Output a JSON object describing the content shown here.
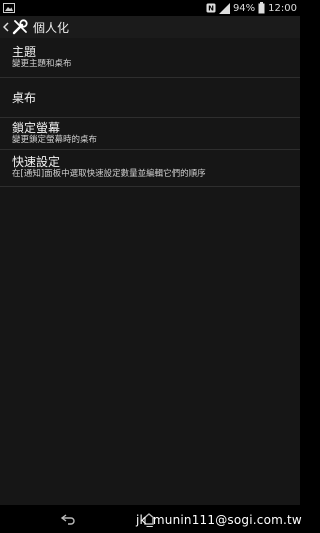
{
  "status_bar": {
    "battery": "94%",
    "time": "12:00",
    "icons": [
      "image-icon",
      "nfc-icon",
      "signal-icon",
      "battery-icon"
    ]
  },
  "action_bar": {
    "title": "個人化",
    "icon": "wrench-screwdriver-icon"
  },
  "items": [
    {
      "title": "主題",
      "summary": "變更主題和桌布"
    },
    {
      "title": "桌布",
      "summary": ""
    },
    {
      "title": "鎖定螢幕",
      "summary": "變更鎖定螢幕時的桌布"
    },
    {
      "title": "快速設定",
      "summary": "在[通知]面板中選取快速設定數量並編輯它們的順序"
    }
  ],
  "watermark": "jk_munin111@sogi.com.tw",
  "colors": {
    "background": "#161616",
    "status_bar": "#000000",
    "divider": "#2e2e2e",
    "text": "#f2f2f2"
  }
}
